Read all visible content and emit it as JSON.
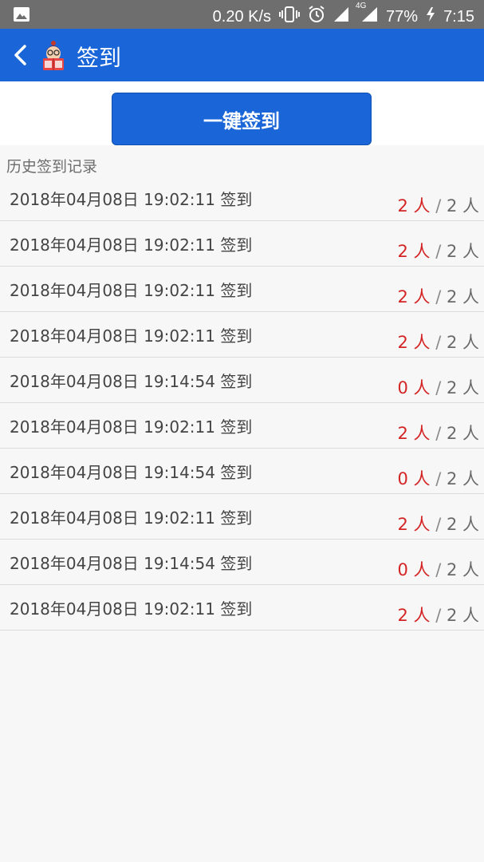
{
  "status_bar": {
    "speed": "0.20 K/s",
    "network": "4G",
    "battery": "77%",
    "time": "7:15"
  },
  "app_bar": {
    "title": "签到"
  },
  "sign_in_button": {
    "label": "一键签到"
  },
  "history": {
    "label": "历史签到记录",
    "records": [
      {
        "datetime": "2018年04月08日 19:02:11",
        "action": "签到",
        "present": "2 人",
        "sep": " / ",
        "total": "2 人"
      },
      {
        "datetime": "2018年04月08日 19:02:11",
        "action": "签到",
        "present": "2 人",
        "sep": " / ",
        "total": "2 人"
      },
      {
        "datetime": "2018年04月08日 19:02:11",
        "action": "签到",
        "present": "2 人",
        "sep": " / ",
        "total": "2 人"
      },
      {
        "datetime": "2018年04月08日 19:02:11",
        "action": "签到",
        "present": "2 人",
        "sep": " / ",
        "total": "2 人"
      },
      {
        "datetime": "2018年04月08日 19:14:54",
        "action": "签到",
        "present": "0 人",
        "sep": " / ",
        "total": "2 人"
      },
      {
        "datetime": "2018年04月08日 19:02:11",
        "action": "签到",
        "present": "2 人",
        "sep": " / ",
        "total": "2 人"
      },
      {
        "datetime": "2018年04月08日 19:14:54",
        "action": "签到",
        "present": "0 人",
        "sep": " / ",
        "total": "2 人"
      },
      {
        "datetime": "2018年04月08日 19:02:11",
        "action": "签到",
        "present": "2 人",
        "sep": " / ",
        "total": "2 人"
      },
      {
        "datetime": "2018年04月08日 19:14:54",
        "action": "签到",
        "present": "0 人",
        "sep": " / ",
        "total": "2 人"
      },
      {
        "datetime": "2018年04月08日 19:02:11",
        "action": "签到",
        "present": "2 人",
        "sep": " / ",
        "total": "2 人"
      }
    ]
  },
  "colors": {
    "primary": "#1a66d8",
    "present_count": "#d42424",
    "status_bar": "#6e6e6e"
  },
  "icons": {
    "back": "back-arrow-icon",
    "logo": "app-logo-icon",
    "gallery": "image-icon",
    "vibrate": "vibrate-icon",
    "alarm": "alarm-icon",
    "signal": "signal-icon",
    "battery_charging": "charging-icon"
  }
}
